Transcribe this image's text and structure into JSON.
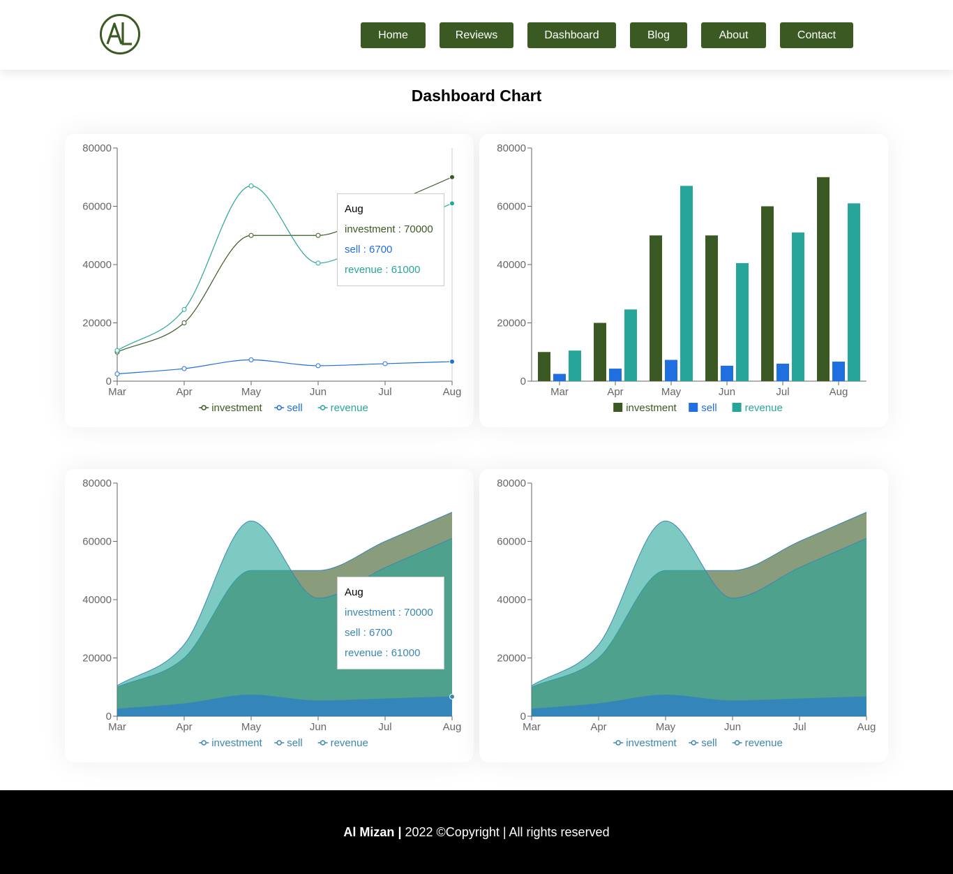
{
  "brand": {
    "logo_text": "AL",
    "color": "#3b5a23"
  },
  "nav": {
    "items": [
      {
        "label": "Home"
      },
      {
        "label": "Reviews"
      },
      {
        "label": "Dashboard"
      },
      {
        "label": "Blog"
      },
      {
        "label": "About"
      },
      {
        "label": "Contact"
      }
    ]
  },
  "page": {
    "title": "Dashboard Chart"
  },
  "colors": {
    "investment": "#3b5a23",
    "sell": "#1f6fe0",
    "revenue": "#26a69a",
    "area_stroke": "#3a86b4"
  },
  "chart_data": [
    {
      "type": "line",
      "categories": [
        "Mar",
        "Apr",
        "May",
        "Jun",
        "Jul",
        "Aug"
      ],
      "series": [
        {
          "name": "investment",
          "values": [
            10000,
            20000,
            50000,
            50000,
            60000,
            70000
          ]
        },
        {
          "name": "sell",
          "values": [
            2500,
            4300,
            7300,
            5300,
            6000,
            6700
          ]
        },
        {
          "name": "revenue",
          "values": [
            10500,
            24600,
            67000,
            40500,
            51000,
            61000
          ]
        }
      ],
      "ylim": [
        0,
        80000
      ],
      "yticks": [
        0,
        20000,
        40000,
        60000,
        80000
      ],
      "legend": "bottom",
      "tooltip": {
        "title": "Aug",
        "lines": [
          "investment : 70000",
          "sell : 6700",
          "revenue : 61000"
        ]
      }
    },
    {
      "type": "bar",
      "categories": [
        "Mar",
        "Apr",
        "May",
        "Jun",
        "Jul",
        "Aug"
      ],
      "series": [
        {
          "name": "investment",
          "values": [
            10000,
            20000,
            50000,
            50000,
            60000,
            70000
          ]
        },
        {
          "name": "sell",
          "values": [
            2500,
            4300,
            7300,
            5300,
            6000,
            6700
          ]
        },
        {
          "name": "revenue",
          "values": [
            10500,
            24600,
            67000,
            40500,
            51000,
            61000
          ]
        }
      ],
      "ylim": [
        0,
        80000
      ],
      "yticks": [
        0,
        20000,
        40000,
        60000,
        80000
      ],
      "legend": "bottom"
    },
    {
      "type": "area",
      "categories": [
        "Mar",
        "Apr",
        "May",
        "Jun",
        "Jul",
        "Aug"
      ],
      "series": [
        {
          "name": "investment",
          "values": [
            10000,
            20000,
            50000,
            50000,
            60000,
            70000
          ]
        },
        {
          "name": "sell",
          "values": [
            2500,
            4300,
            7300,
            5300,
            6000,
            6700
          ]
        },
        {
          "name": "revenue",
          "values": [
            10500,
            24600,
            67000,
            40500,
            51000,
            61000
          ]
        }
      ],
      "ylim": [
        0,
        80000
      ],
      "yticks": [
        0,
        20000,
        40000,
        60000,
        80000
      ],
      "legend": "bottom",
      "tooltip": {
        "title": "Aug",
        "lines": [
          "investment : 70000",
          "sell : 6700",
          "revenue : 61000"
        ]
      }
    },
    {
      "type": "area",
      "categories": [
        "Mar",
        "Apr",
        "May",
        "Jun",
        "Jul",
        "Aug"
      ],
      "series": [
        {
          "name": "investment",
          "values": [
            10000,
            20000,
            50000,
            50000,
            60000,
            70000
          ]
        },
        {
          "name": "sell",
          "values": [
            2500,
            4300,
            7300,
            5300,
            6000,
            6700
          ]
        },
        {
          "name": "revenue",
          "values": [
            10500,
            24600,
            67000,
            40500,
            51000,
            61000
          ]
        }
      ],
      "ylim": [
        0,
        80000
      ],
      "yticks": [
        0,
        20000,
        40000,
        60000,
        80000
      ],
      "legend": "bottom"
    }
  ],
  "footer": {
    "brand": "Al Mizan",
    "separator": "|",
    "text": "2022 ©Copyright | All rights reserved"
  }
}
